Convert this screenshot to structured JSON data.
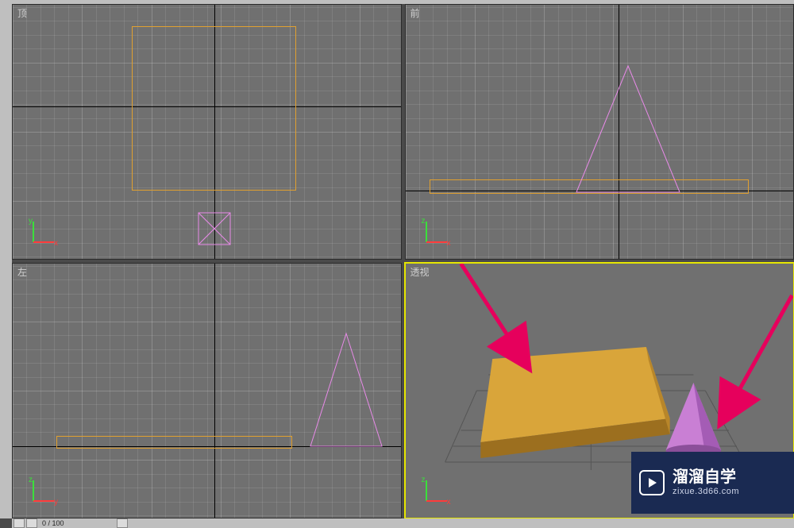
{
  "viewports": {
    "top": {
      "label": "顶",
      "axis_h": "x",
      "axis_v": "y"
    },
    "front": {
      "label": "前",
      "axis_h": "x",
      "axis_v": "z"
    },
    "left": {
      "label": "左",
      "axis_h": "y",
      "axis_v": "z"
    },
    "persp": {
      "label": "透视",
      "active": true
    }
  },
  "objects": {
    "box": {
      "color": "#e0a030"
    },
    "cone": {
      "color": "#e88ae8",
      "shaded": "#c97fd4"
    }
  },
  "annotations": {
    "arrow_color": "#e6005c"
  },
  "watermark": {
    "title": "溜溜自学",
    "url": "zixue.3d66.com"
  },
  "timeline": {
    "label": "0 / 100"
  }
}
